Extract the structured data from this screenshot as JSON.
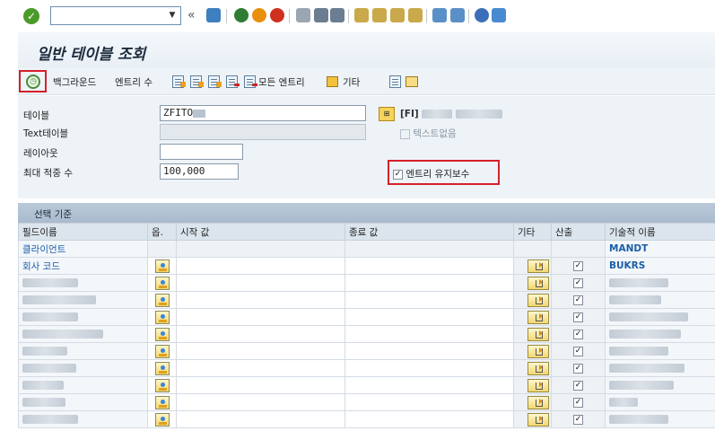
{
  "system_toolbar": {
    "command_value": "",
    "icons": [
      "confirm-icon",
      "dropdown-icon",
      "back-icon",
      "save-icon",
      "back-green-icon",
      "exit-icon",
      "cancel-icon",
      "print-icon",
      "find-icon",
      "find-next-icon",
      "first-page-icon",
      "prev-page-icon",
      "next-page-icon",
      "last-page-icon",
      "new-session-icon",
      "shortcut-icon",
      "help-icon",
      "layout-icon"
    ],
    "colors": {
      "confirm": "#4c9a2a",
      "back": "#2f7d32",
      "exit": "#e8900c",
      "cancel": "#d03020",
      "help": "#3b6fb8"
    }
  },
  "page_title": "일반 테이블 조회",
  "app_toolbar": {
    "execute_icon": "execute-icon",
    "background_label": "백그라운드",
    "entry_count_label": "엔트리 수",
    "all_entries_label": "모든 엔트리",
    "other_label": "기타",
    "icons": [
      "table-doc-icon",
      "table-doc-icon",
      "table-doc-icon",
      "table-doc-red-icon",
      "table-doc-red-icon",
      "arrow-orange-icon",
      "doc-view-icon",
      "export-icon"
    ]
  },
  "form": {
    "table_label": "테이블",
    "table_value": "ZFITO",
    "text_table_label": "Text테이블",
    "text_table_value": "",
    "layout_label": "레이아웃",
    "layout_value": "",
    "max_hits_label": "최대 적중 수",
    "max_hits_value": "100,000",
    "table_desc_prefix": "[FI]",
    "no_text_label": "텍스트없음",
    "maintain_entries_label": "엔트리 유지보수",
    "maintain_entries_checked": true
  },
  "selection": {
    "header": "선택 기준",
    "columns": {
      "field_name": "필드이름",
      "option": "옵.",
      "from": "시작 값",
      "to": "종료 값",
      "more": "기타",
      "output": "산출",
      "tech_name": "기술적 이름"
    },
    "rows": [
      {
        "field": "클라이언트",
        "tech": "MANDT",
        "editable": false
      },
      {
        "field": "회사 코드",
        "tech": "BUKRS",
        "editable": true,
        "output": "✓"
      },
      {
        "field": "",
        "tech": "",
        "editable": true,
        "output": "✓"
      },
      {
        "field": "",
        "tech": "",
        "editable": true,
        "output": "✓"
      },
      {
        "field": "",
        "tech": "",
        "editable": true,
        "output": "✓"
      },
      {
        "field": "",
        "tech": "",
        "editable": true,
        "output": "✓"
      },
      {
        "field": "",
        "tech": "",
        "editable": true,
        "output": "✓"
      },
      {
        "field": "",
        "tech": "",
        "editable": true,
        "output": "✓"
      },
      {
        "field": "",
        "tech": "",
        "editable": true,
        "output": "✓"
      },
      {
        "field": "",
        "tech": "",
        "editable": true,
        "output": "✓"
      },
      {
        "field": "",
        "tech": "",
        "editable": true,
        "output": "✓"
      }
    ]
  }
}
